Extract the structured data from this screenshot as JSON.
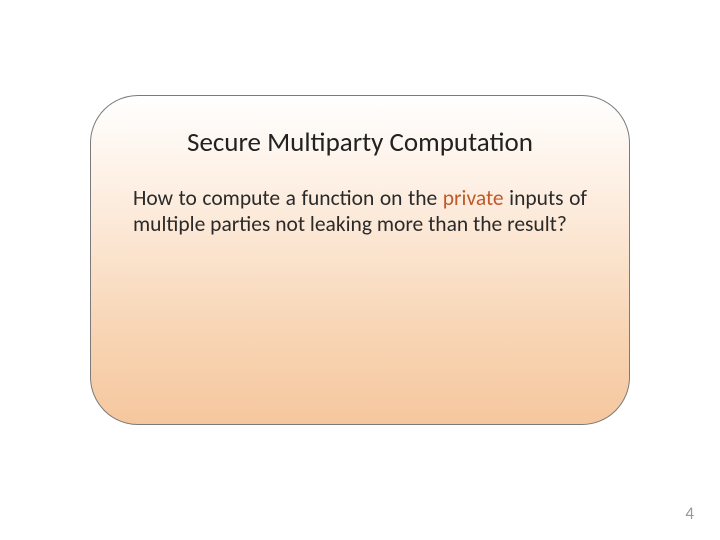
{
  "card": {
    "title": "Secure Multiparty Computation",
    "body_seg1": "How to compute a function on the ",
    "body_private": "private",
    "body_seg2": " inputs of multiple parties not leaking more than the result?"
  },
  "page_number": "4"
}
